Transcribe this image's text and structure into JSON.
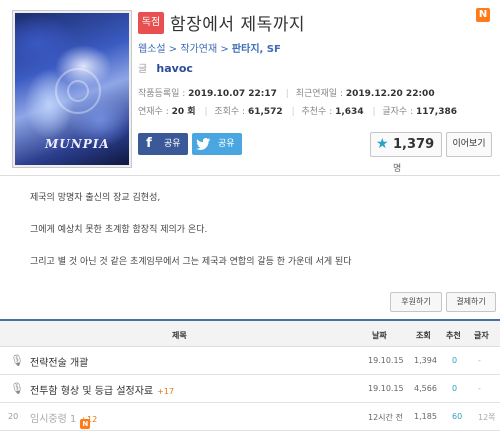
{
  "novel": {
    "badge": "독점",
    "title": "함장에서 제독까지",
    "new_badge": "N",
    "breadcrumb": {
      "site": "웹소설",
      "section": "작가연재",
      "genres": "판타지, SF"
    },
    "author_label": "글",
    "author": "havoc",
    "cover_logo": "MUNPIA"
  },
  "meta": {
    "first_label": "작품등록일 :",
    "first_value": "2019.10.07 22:17",
    "last_label": "최근연재일 :",
    "last_value": "2019.12.20 22:00",
    "episodes_label": "연재수 :",
    "episodes_value": "20 회",
    "views_label": "조회수 :",
    "views_value": "61,572",
    "recs_label": "추천수 :",
    "recs_value": "1,634",
    "chars_label": "글자수 :",
    "chars_value": "117,386"
  },
  "actions": {
    "facebook_icon": "f",
    "facebook_label": "공유",
    "twitter_label": "공유",
    "recommend_count": "1,379",
    "recommend_unit": "명",
    "continue_label": "이어보기"
  },
  "description": [
    "제국의 망명자 출신의 장교 김현성,",
    "그에게 예상치 못한 초계함 함장직 제의가 온다.",
    "그리고 별 것 아닌 것 같은 초계임무에서 그는 제국과 연합의 갈등 한 가운데 서게 된다"
  ],
  "support": {
    "sponsor_label": "후원하기",
    "pay_label": "결제하기"
  },
  "table": {
    "headers": {
      "title": "제목",
      "date": "날짜",
      "views": "조회",
      "recs": "추천",
      "chars": "글자"
    },
    "rows": [
      {
        "num": "",
        "title": "전략전술 개괄",
        "up": "",
        "date": "19.10.15",
        "views": "1,394",
        "recs": "0",
        "chars": "-"
      },
      {
        "num": "",
        "title": "전투함 형상 및 등급 설정자료",
        "up": "+17",
        "date": "19.10.15",
        "views": "4,566",
        "recs": "0",
        "chars": "-"
      },
      {
        "num": "20",
        "title": "임시중령 1",
        "up": "+12",
        "date": "12시간 전",
        "views": "1,185",
        "recs": "60",
        "chars": "12쪽"
      }
    ]
  },
  "colors": {
    "accent_blue": "#3b6db5",
    "badge_red": "#e94f4f",
    "new_orange": "#ff7a18",
    "recommend_teal": "#2aa1c6"
  }
}
